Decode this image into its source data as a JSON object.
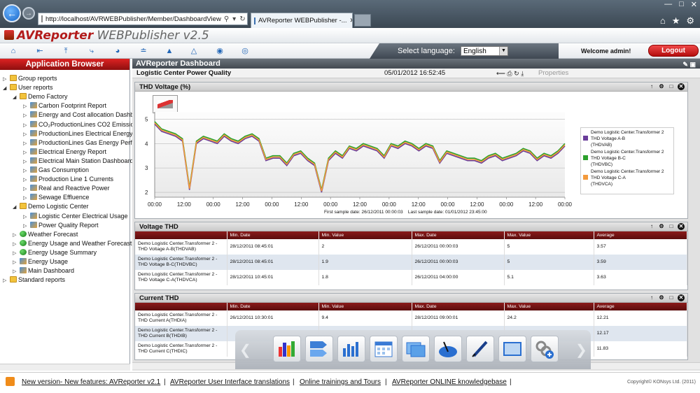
{
  "browser": {
    "url": "http://localhost/AVRWEBPublisher/Member/DashboardView",
    "tab_title": "AVReporter WEBPublisher -..."
  },
  "app": {
    "brand_av": "AVReporter",
    "brand_pub": "WEBPublisher",
    "version": "v2.5"
  },
  "header": {
    "select_language_label": "Select language:",
    "language": "English",
    "welcome": "Welcome  admin!",
    "logout": "Logout"
  },
  "sidebar": {
    "title": "Application Browser",
    "items": [
      {
        "label": "Group reports",
        "depth": 0,
        "expanded": false,
        "icon": "folder-icon"
      },
      {
        "label": "User reports",
        "depth": 0,
        "expanded": true,
        "icon": "folder-icon"
      },
      {
        "label": "Demo Factory",
        "depth": 1,
        "expanded": true,
        "icon": "folder-icon"
      },
      {
        "label": "Carbon Footprint Report",
        "depth": 2,
        "icon": "report-icon"
      },
      {
        "label": "Energy and Cost allocation Dashb",
        "depth": 2,
        "icon": "report-icon"
      },
      {
        "label": "CO₂ProductionLines CO2 Emission",
        "depth": 2,
        "icon": "report-icon"
      },
      {
        "label": "ProductionLines Electrical Energy",
        "depth": 2,
        "icon": "report-icon"
      },
      {
        "label": "ProductionLines Gas Energy Perf",
        "depth": 2,
        "icon": "report-icon"
      },
      {
        "label": "Electrical Energy Report",
        "depth": 2,
        "icon": "report-icon"
      },
      {
        "label": "Electrical Main Station Dashboard",
        "depth": 2,
        "icon": "report-icon"
      },
      {
        "label": "Gas Consumption",
        "depth": 2,
        "icon": "report-icon"
      },
      {
        "label": "Production Line 1 Currents",
        "depth": 2,
        "icon": "report-icon"
      },
      {
        "label": "Real and Reactive Power",
        "depth": 2,
        "icon": "report-icon"
      },
      {
        "label": "Sewage Effluence",
        "depth": 2,
        "icon": "report-icon"
      },
      {
        "label": "Demo Logistic Center",
        "depth": 1,
        "expanded": true,
        "icon": "folder-icon"
      },
      {
        "label": "Logistic Center Electrical Usage",
        "depth": 2,
        "icon": "report-icon"
      },
      {
        "label": "Power Quality Report",
        "depth": 2,
        "icon": "report-icon"
      },
      {
        "label": "Weather Forecast",
        "depth": 1,
        "icon": "globe-icon"
      },
      {
        "label": "Energy Usage and Weather Forecast",
        "depth": 1,
        "icon": "globe-icon"
      },
      {
        "label": "Energy Usage Summary",
        "depth": 1,
        "icon": "globe-icon"
      },
      {
        "label": "Energy Usage",
        "depth": 1,
        "icon": "report-icon"
      },
      {
        "label": "Main Dashboard",
        "depth": 1,
        "icon": "report-icon"
      },
      {
        "label": "Standard reports",
        "depth": 0,
        "icon": "folder-icon"
      }
    ]
  },
  "dashboard": {
    "title": "AVReporter Dashboard",
    "subtitle": "Logistic Center Power Quality",
    "date": "05/01/2012 16:52:45",
    "properties": "Properties"
  },
  "thd_panel": {
    "title": "THD Voltage (%)",
    "first_sample": "First sample date:  26/12/2011 00:00:03",
    "last_sample": "Last sample date:  01/01/2012 23:45:00"
  },
  "chart_data": {
    "type": "line",
    "x_ticks": [
      "00:00",
      "12:00",
      "00:00",
      "12:00",
      "00:00",
      "12:00",
      "00:00",
      "12:00",
      "00:00",
      "12:00",
      "00:00",
      "12:00",
      "00:00",
      "12:00",
      "00:00"
    ],
    "ylim": [
      1.8,
      5.3
    ],
    "y_ticks": [
      "2",
      "3",
      "4",
      "5"
    ],
    "grid": true,
    "legend_placement": "right",
    "series": [
      {
        "name": "Demo Logistic Center.Transformer 2 THD  Voltage A-B (THDVAB)",
        "color": "#6a3d9a",
        "values": [
          4.8,
          4.5,
          4.4,
          4.3,
          4.1,
          2.1,
          4.0,
          4.2,
          4.1,
          4.0,
          4.3,
          4.1,
          4.0,
          4.2,
          4.3,
          4.1,
          3.3,
          3.4,
          3.4,
          3.1,
          3.5,
          3.6,
          3.3,
          3.1,
          2.0,
          3.3,
          3.6,
          3.4,
          3.8,
          3.7,
          3.9,
          3.8,
          3.7,
          3.4,
          3.9,
          3.8,
          4.0,
          3.9,
          3.7,
          3.9,
          3.8,
          3.2,
          3.6,
          3.5,
          3.4,
          3.3,
          3.3,
          3.2,
          3.4,
          3.5,
          3.3,
          3.4,
          3.5,
          3.7,
          3.6,
          3.3,
          3.5,
          3.4,
          3.6,
          3.9
        ]
      },
      {
        "name": "Demo Logistic Center.Transformer 2 THD  Voltage B-C (THDVBC)",
        "color": "#2ca02c",
        "values": [
          4.9,
          4.6,
          4.5,
          4.4,
          4.2,
          2.2,
          4.1,
          4.3,
          4.2,
          4.1,
          4.4,
          4.2,
          4.1,
          4.3,
          4.4,
          4.2,
          3.4,
          3.5,
          3.5,
          3.2,
          3.6,
          3.7,
          3.4,
          3.2,
          2.1,
          3.4,
          3.7,
          3.5,
          3.9,
          3.8,
          4.0,
          3.9,
          3.8,
          3.5,
          4.0,
          3.9,
          4.1,
          4.0,
          3.8,
          4.0,
          3.9,
          3.3,
          3.7,
          3.6,
          3.5,
          3.4,
          3.4,
          3.3,
          3.5,
          3.6,
          3.4,
          3.5,
          3.6,
          3.8,
          3.7,
          3.4,
          3.6,
          3.5,
          3.7,
          4.0
        ]
      },
      {
        "name": "Demo Logistic Center.Transformer 2 THD  Voltage C-A (THDVCA)",
        "color": "#f39a3c",
        "values": [
          4.85,
          4.55,
          4.45,
          4.35,
          4.15,
          2.15,
          4.05,
          4.25,
          4.15,
          4.05,
          4.35,
          4.15,
          4.05,
          4.25,
          4.35,
          4.15,
          3.35,
          3.45,
          3.45,
          3.15,
          3.55,
          3.65,
          3.35,
          3.15,
          2.05,
          3.35,
          3.65,
          3.45,
          3.85,
          3.75,
          3.95,
          3.85,
          3.75,
          3.45,
          3.95,
          3.85,
          4.05,
          3.95,
          3.75,
          3.95,
          3.85,
          3.25,
          3.65,
          3.55,
          3.45,
          3.35,
          3.35,
          3.25,
          3.45,
          3.55,
          3.35,
          3.45,
          3.55,
          3.75,
          3.65,
          3.35,
          3.55,
          3.45,
          3.65,
          3.95
        ]
      }
    ]
  },
  "legend": {
    "s1a": "Demo Logistic Center.Transformer 2",
    "s1b": "THD  Voltage A-B",
    "s1c": "(THDVAB)",
    "s2a": "Demo Logistic Center.Transformer 2",
    "s2b": "THD  Voltage B-C",
    "s2c": "(THDVBC)",
    "s3a": "Demo Logistic Center.Transformer 2",
    "s3b": "THD  Voltage C-A",
    "s3c": "(THDVCA)"
  },
  "voltage_table": {
    "title": "Voltage THD",
    "headers": [
      "",
      "Min. Date",
      "Min. Value",
      "Max. Date",
      "Max. Value",
      "Average"
    ],
    "rows": [
      [
        "Demo Logistic Center.Transformer 2 - THD  Voltage A-B(THDVAB)",
        "28/12/2011 08:45:01",
        "2",
        "26/12/2011 00:00:03",
        "5",
        "3.57"
      ],
      [
        "Demo Logistic Center.Transformer 2 - THD  Voltage B-C(THDVBC)",
        "28/12/2011 08:45:01",
        "1.9",
        "26/12/2011 00:00:03",
        "5",
        "3.59"
      ],
      [
        "Demo Logistic Center.Transformer 2 - THD  Voltage C-A(THDVCA)",
        "28/12/2011 10:45:01",
        "1.8",
        "26/12/2011 04:00:00",
        "5.1",
        "3.63"
      ]
    ]
  },
  "current_table": {
    "title": "Current THD",
    "headers": [
      "",
      "Min. Date",
      "Min. Value",
      "Max. Date",
      "Max. Value",
      "Average"
    ],
    "rows": [
      [
        "Demo Logistic Center.Transformer 2 - THD  Current A(THDIA)",
        "26/12/2011 10:30:01",
        "9.4",
        "28/12/2011 09:00:01",
        "24.2",
        "12.21"
      ],
      [
        "Demo Logistic Center.Transformer 2 - THD  Current B(THDIB)",
        "",
        "",
        "",
        "",
        "12.17"
      ],
      [
        "Demo Logistic Center.Transformer 2 - THD  Current C(THDIC)",
        "",
        "",
        "",
        "",
        "11.83"
      ]
    ]
  },
  "footer": {
    "link1": "New version- New features: AVReporter v2.1",
    "link2": "AVReporter User Interface translations",
    "link3": "Online trainings and Tours",
    "link4": "AVReporter ONLINE knowledgebase",
    "copyright": "Copyright© KONsys Ltd. (2011)"
  }
}
